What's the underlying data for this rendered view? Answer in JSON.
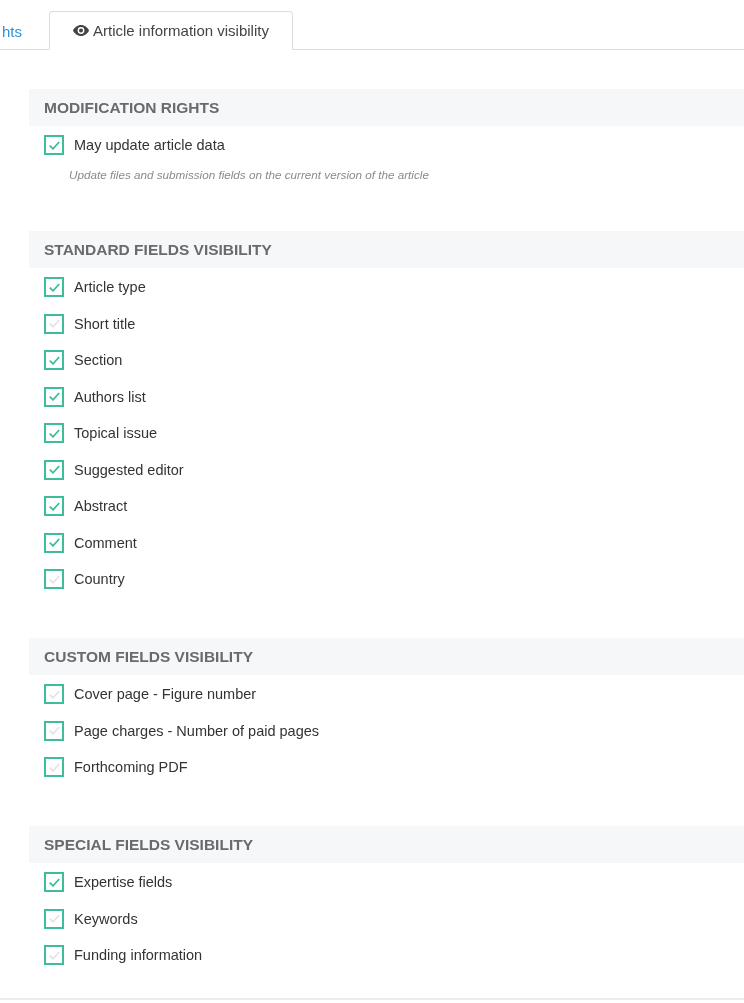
{
  "tabs": [
    {
      "label": "hts",
      "selected": false,
      "has_icon": false
    },
    {
      "label": "Article information visibility",
      "selected": true,
      "has_icon": true
    }
  ],
  "sections": [
    {
      "title": "MODIFICATION RIGHTS",
      "items": [
        {
          "label": "May update article data",
          "checked": true,
          "help": "Update files and submission fields on the current version of the article"
        }
      ]
    },
    {
      "title": "STANDARD FIELDS VISIBILITY",
      "items": [
        {
          "label": "Article type",
          "checked": true
        },
        {
          "label": "Short title",
          "checked": false
        },
        {
          "label": "Section",
          "checked": true
        },
        {
          "label": "Authors list",
          "checked": true
        },
        {
          "label": "Topical issue",
          "checked": true
        },
        {
          "label": "Suggested editor",
          "checked": true
        },
        {
          "label": "Abstract",
          "checked": true
        },
        {
          "label": "Comment",
          "checked": true
        },
        {
          "label": "Country",
          "checked": false
        }
      ]
    },
    {
      "title": "CUSTOM FIELDS VISIBILITY",
      "items": [
        {
          "label": "Cover page - Figure number",
          "checked": false
        },
        {
          "label": "Page charges - Number of paid pages",
          "checked": false
        },
        {
          "label": "Forthcoming PDF",
          "checked": false
        }
      ]
    },
    {
      "title": "SPECIAL FIELDS VISIBILITY",
      "items": [
        {
          "label": "Expertise fields",
          "checked": true
        },
        {
          "label": "Keywords",
          "checked": false
        },
        {
          "label": "Funding information",
          "checked": false
        }
      ]
    }
  ]
}
